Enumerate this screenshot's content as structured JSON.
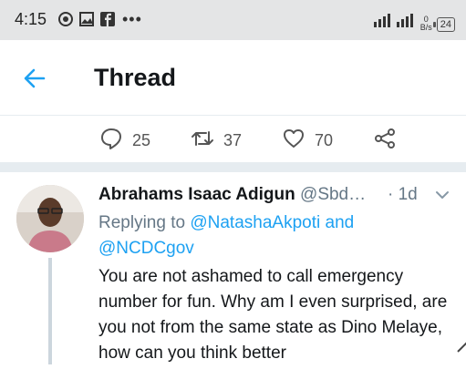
{
  "status_bar": {
    "time": "4:15",
    "icons": [
      "chat-bubble-icon",
      "image-icon",
      "facebook-icon"
    ],
    "more": "•••",
    "net_speed_value": "0",
    "net_speed_unit": "B/s",
    "battery": "24"
  },
  "header": {
    "title": "Thread",
    "back_icon": "arrow-left-icon"
  },
  "actions": {
    "reply_count": "25",
    "retweet_count": "37",
    "like_count": "70"
  },
  "tweet": {
    "author_name": "Abrahams Isaac Adigun",
    "author_handle": "@Sbd…",
    "time": "· 1d",
    "replying_prefix": "Replying to ",
    "mention_1": "@NatashaAkpoti",
    "replying_and": " and",
    "mention_2": "@NCDCgov",
    "text": "You are not ashamed to call emergency number for fun. Why am I even surprised, are you not from the same state as Dino Melaye, how can you think better"
  },
  "colors": {
    "accent": "#1da1f2",
    "secondary_text": "#657786",
    "status_bar_bg": "#e4e5e6"
  }
}
